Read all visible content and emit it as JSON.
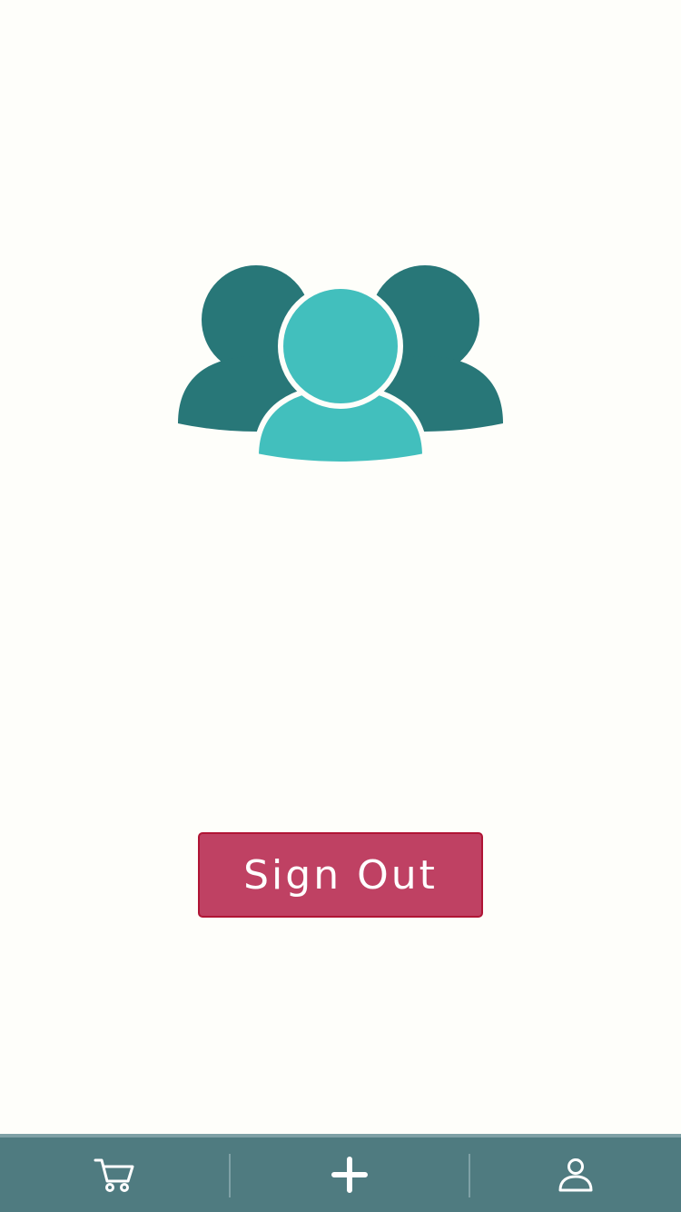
{
  "colors": {
    "background": "#FEFEFA",
    "people_dark": "#287778",
    "people_light": "#42BFBD",
    "signout_fill": "#BF4163",
    "signout_border": "#B01535",
    "tabbar": "#4F7B80",
    "tabbar_accent": "#7FA1A6"
  },
  "hero": {
    "icon": "people-group-icon"
  },
  "signout": {
    "label": "Sign Out"
  },
  "tabbar": {
    "tabs": [
      {
        "icon": "cart-icon"
      },
      {
        "icon": "plus-icon"
      },
      {
        "icon": "user-icon"
      }
    ]
  }
}
